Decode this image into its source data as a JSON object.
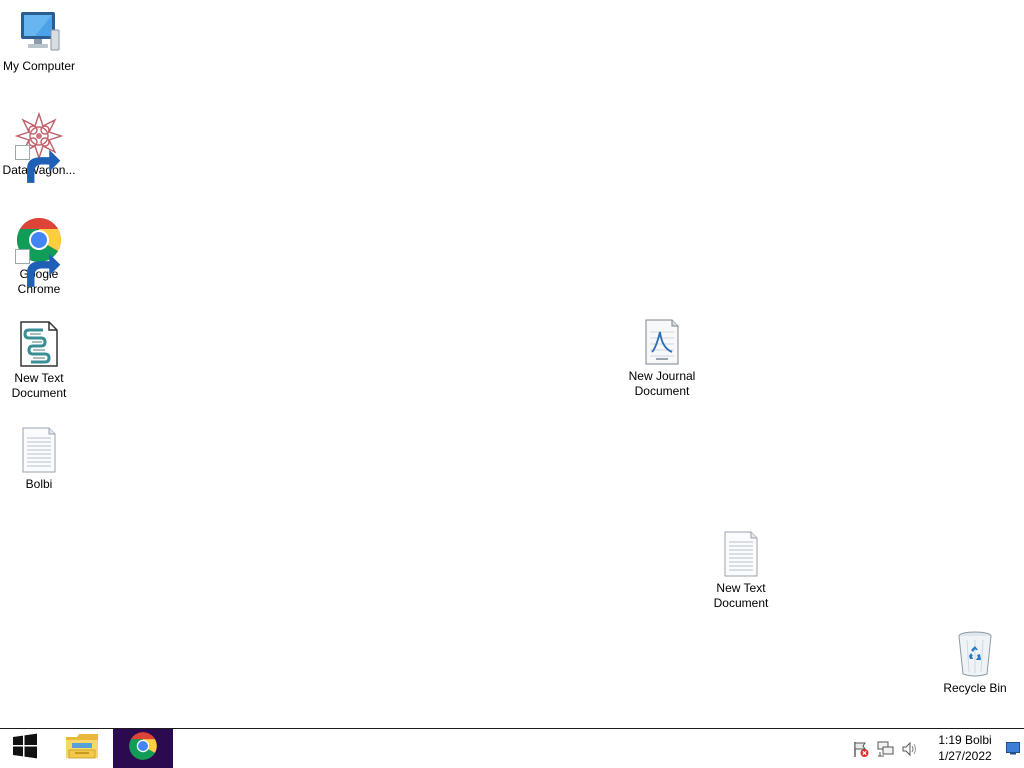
{
  "desktop": {
    "icons": [
      {
        "id": "my-computer",
        "label": "My Computer",
        "icon": "computer-icon"
      },
      {
        "id": "datawagon",
        "label": "DataWagon...",
        "icon": "datawagon-icon",
        "shortcut": true
      },
      {
        "id": "google-chrome",
        "label": "Google\nChrome",
        "icon": "chrome-icon",
        "shortcut": true
      },
      {
        "id": "new-text-doc-script",
        "label": "New Text\nDocument",
        "icon": "script-document-icon"
      },
      {
        "id": "bolbi",
        "label": "Bolbi",
        "icon": "text-document-icon"
      },
      {
        "id": "new-journal-doc",
        "label": "New Journal\nDocument",
        "icon": "journal-document-icon"
      },
      {
        "id": "new-text-doc",
        "label": "New Text\nDocument",
        "icon": "text-document-icon"
      },
      {
        "id": "recycle-bin",
        "label": "Recycle Bin",
        "icon": "recycle-bin-icon"
      }
    ]
  },
  "taskbar": {
    "start_icon": "windows-start-icon",
    "pinned": [
      {
        "id": "file-explorer",
        "icon": "folder-icon"
      },
      {
        "id": "chrome",
        "icon": "chrome-icon",
        "active": true
      }
    ],
    "tray": {
      "icons": [
        "action-center-flag-icon",
        "network-icon",
        "volume-icon"
      ],
      "time": "1:19 Bolbi",
      "date": "1/27/2022"
    }
  },
  "colors": {
    "active_task_bg": "#2b0a4f",
    "desktop_bg": "#ffffff"
  }
}
